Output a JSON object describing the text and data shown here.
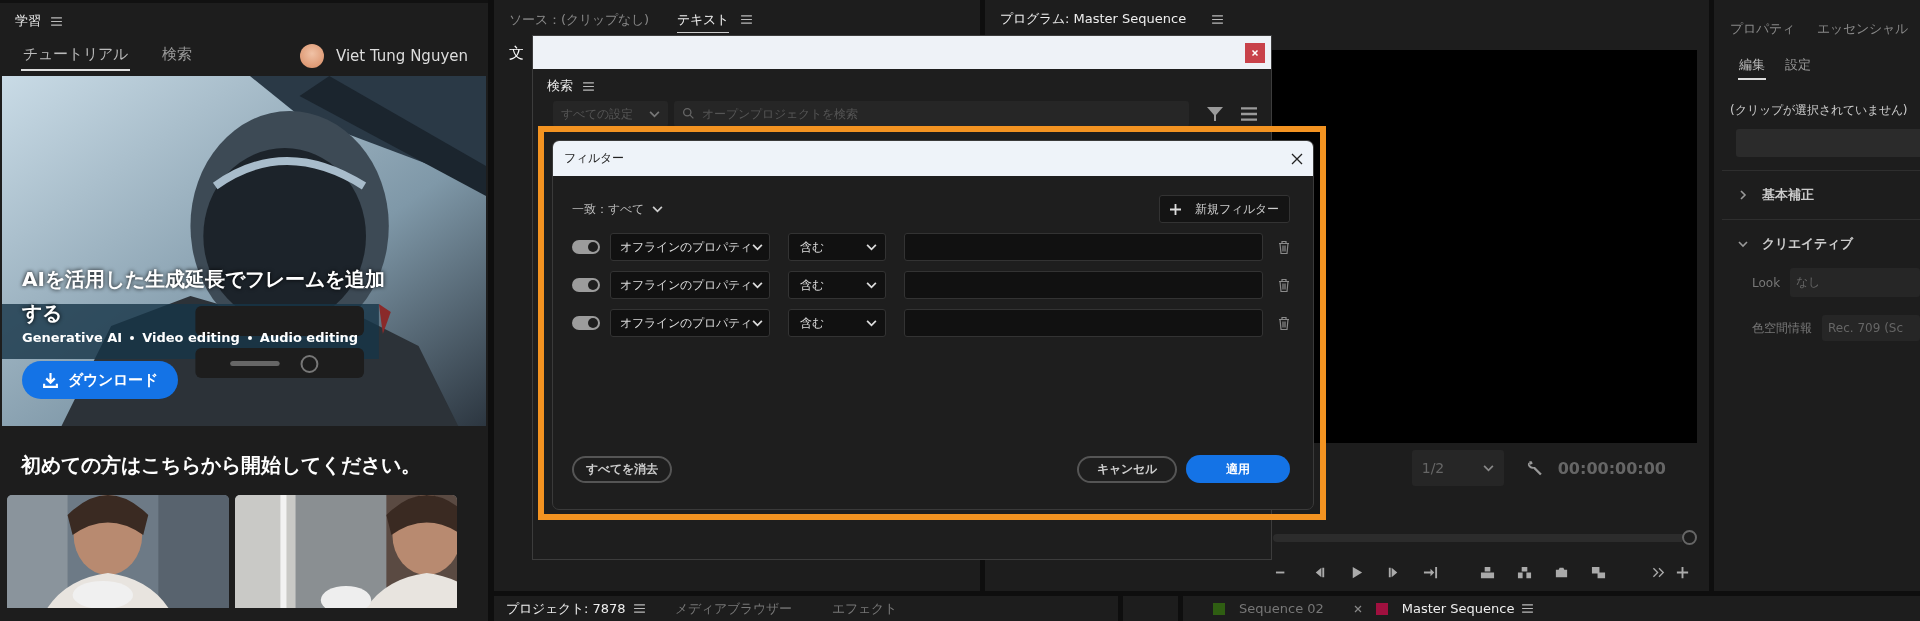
{
  "learn_panel": {
    "title": "学習",
    "tabs": [
      {
        "label": "チュートリアル",
        "selected": true
      },
      {
        "label": "検索",
        "selected": false
      }
    ],
    "user": "Viet Tung Nguyen",
    "hero": {
      "kind": "picture",
      "title": "AIを活用した生成延長でフレームを追加する",
      "tags": [
        "Generative AI",
        "Video editing",
        "Audio editing"
      ],
      "button": "ダウンロード"
    },
    "heading": "初めての方はこちらから開始してください。"
  },
  "source_panel": {
    "tabs": [
      {
        "label": "ソース：(クリップなし)",
        "selected": false
      },
      {
        "label": "テキスト",
        "selected": true
      }
    ],
    "subtab": "文"
  },
  "program_panel": {
    "title": "プログラム: Master Sequence",
    "zoom": "1/2",
    "timecode": "00:00:00:00"
  },
  "properties_panel": {
    "tabs": [
      {
        "label": "プロパティ",
        "selected": false
      },
      {
        "label": "エッセンシャル",
        "selected": false
      }
    ],
    "subtabs": [
      {
        "label": "編集",
        "selected": true
      },
      {
        "label": "設定",
        "selected": false
      }
    ],
    "message": "(クリップが選択されていません)",
    "sections": [
      {
        "label": "基本補正",
        "expanded": false
      },
      {
        "label": "クリエイティブ",
        "expanded": true
      }
    ],
    "fields": [
      {
        "label": "Look",
        "value": "なし"
      },
      {
        "label": "色空間情報",
        "value": "Rec. 709 (Sc"
      }
    ]
  },
  "project_tabs": [
    {
      "label": "プロジェクト: 7878",
      "selected": true
    },
    {
      "label": "メディアブラウザー",
      "selected": false
    },
    {
      "label": "エフェクト",
      "selected": false
    }
  ],
  "timeline_tabs": [
    {
      "label": "Sequence 02",
      "color": "#2f5e12",
      "selected": false
    },
    {
      "label": "Master Sequence",
      "color": "#a0103f",
      "selected": true
    }
  ],
  "search_window": {
    "title": "検索",
    "scope": "すべての設定",
    "placeholder": "オープンプロジェクトを検索"
  },
  "filter_dialog": {
    "title": "フィルター",
    "highlighted": true,
    "match": "一致：すべて",
    "new_button": "新規フィルター",
    "rows": [
      {
        "enabled": true,
        "property": "オフラインのプロパティ",
        "operator": "含む"
      },
      {
        "enabled": true,
        "property": "オフラインのプロパティ",
        "operator": "含む"
      },
      {
        "enabled": true,
        "property": "オフラインのプロパティ",
        "operator": "含む"
      }
    ],
    "clear_button": "すべてを消去",
    "cancel_button": "キャンセル",
    "apply_button": "適用"
  }
}
